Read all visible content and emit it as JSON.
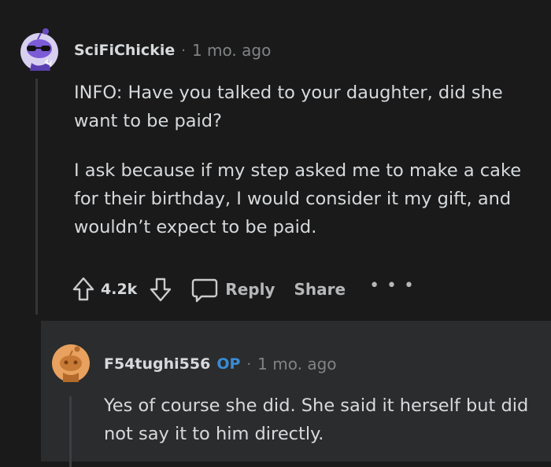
{
  "comment": {
    "username": "SciFiChickie",
    "separator": "·",
    "time": "1 mo. ago",
    "paragraphs": [
      "INFO: Have you talked to your daughter, did she want to be paid?",
      "I ask because if my step asked me to make a cake for their birthday, I would consider it my gift, and wouldn’t expect to be paid."
    ],
    "actions": {
      "vote_count": "4.2k",
      "reply_label": "Reply",
      "share_label": "Share",
      "more_label": "• • •"
    }
  },
  "reply": {
    "username": "F54tughi556",
    "op_badge": "OP",
    "separator": "·",
    "time": "1 mo. ago",
    "text": "Yes of course she did. She said it herself but did not say it to him directly."
  },
  "colors": {
    "background": "#1a1a1b",
    "reply_background": "#2b2c2d",
    "op_accent": "#3a8bd5",
    "avatar1_accent": "#7b5bd6",
    "avatar2_accent": "#e8a15e"
  },
  "icons": [
    "snoo-avatar-purple",
    "arrow-up-icon",
    "arrow-down-icon",
    "comment-icon",
    "more-icon",
    "snoo-avatar-orange"
  ]
}
